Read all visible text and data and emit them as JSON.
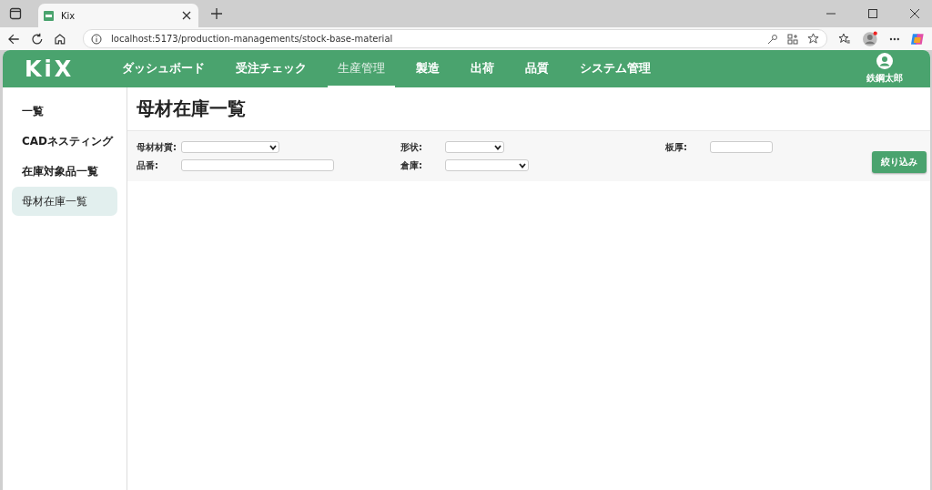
{
  "browser": {
    "tab_title": "Kix",
    "url": "localhost:5173/production-managements/stock-base-material"
  },
  "header": {
    "logo": "KiX",
    "nav": [
      {
        "label": "ダッシュボード",
        "selected": false
      },
      {
        "label": "受注チェック",
        "selected": false
      },
      {
        "label": "生産管理",
        "selected": true
      },
      {
        "label": "製造",
        "selected": false
      },
      {
        "label": "出荷",
        "selected": false
      },
      {
        "label": "品質",
        "selected": false
      },
      {
        "label": "システム管理",
        "selected": false
      }
    ],
    "user_name": "鉄鋼太郎"
  },
  "sidebar": {
    "items": [
      {
        "label": "一覧",
        "selected": false
      },
      {
        "label": "CADネスティング",
        "selected": false
      },
      {
        "label": "在庫対象品一覧",
        "selected": false
      },
      {
        "label": "母材在庫一覧",
        "selected": true
      }
    ]
  },
  "page_title": "母材在庫一覧",
  "filters": [
    {
      "label": "母材材質:",
      "kind": "select"
    },
    {
      "label": "形状:",
      "kind": "select"
    },
    {
      "label": "板厚:",
      "kind": "text"
    },
    {
      "label": "品番:",
      "kind": "text"
    },
    {
      "label": "倉庫:",
      "kind": "select"
    }
  ],
  "filter_button": "絞り込み"
}
